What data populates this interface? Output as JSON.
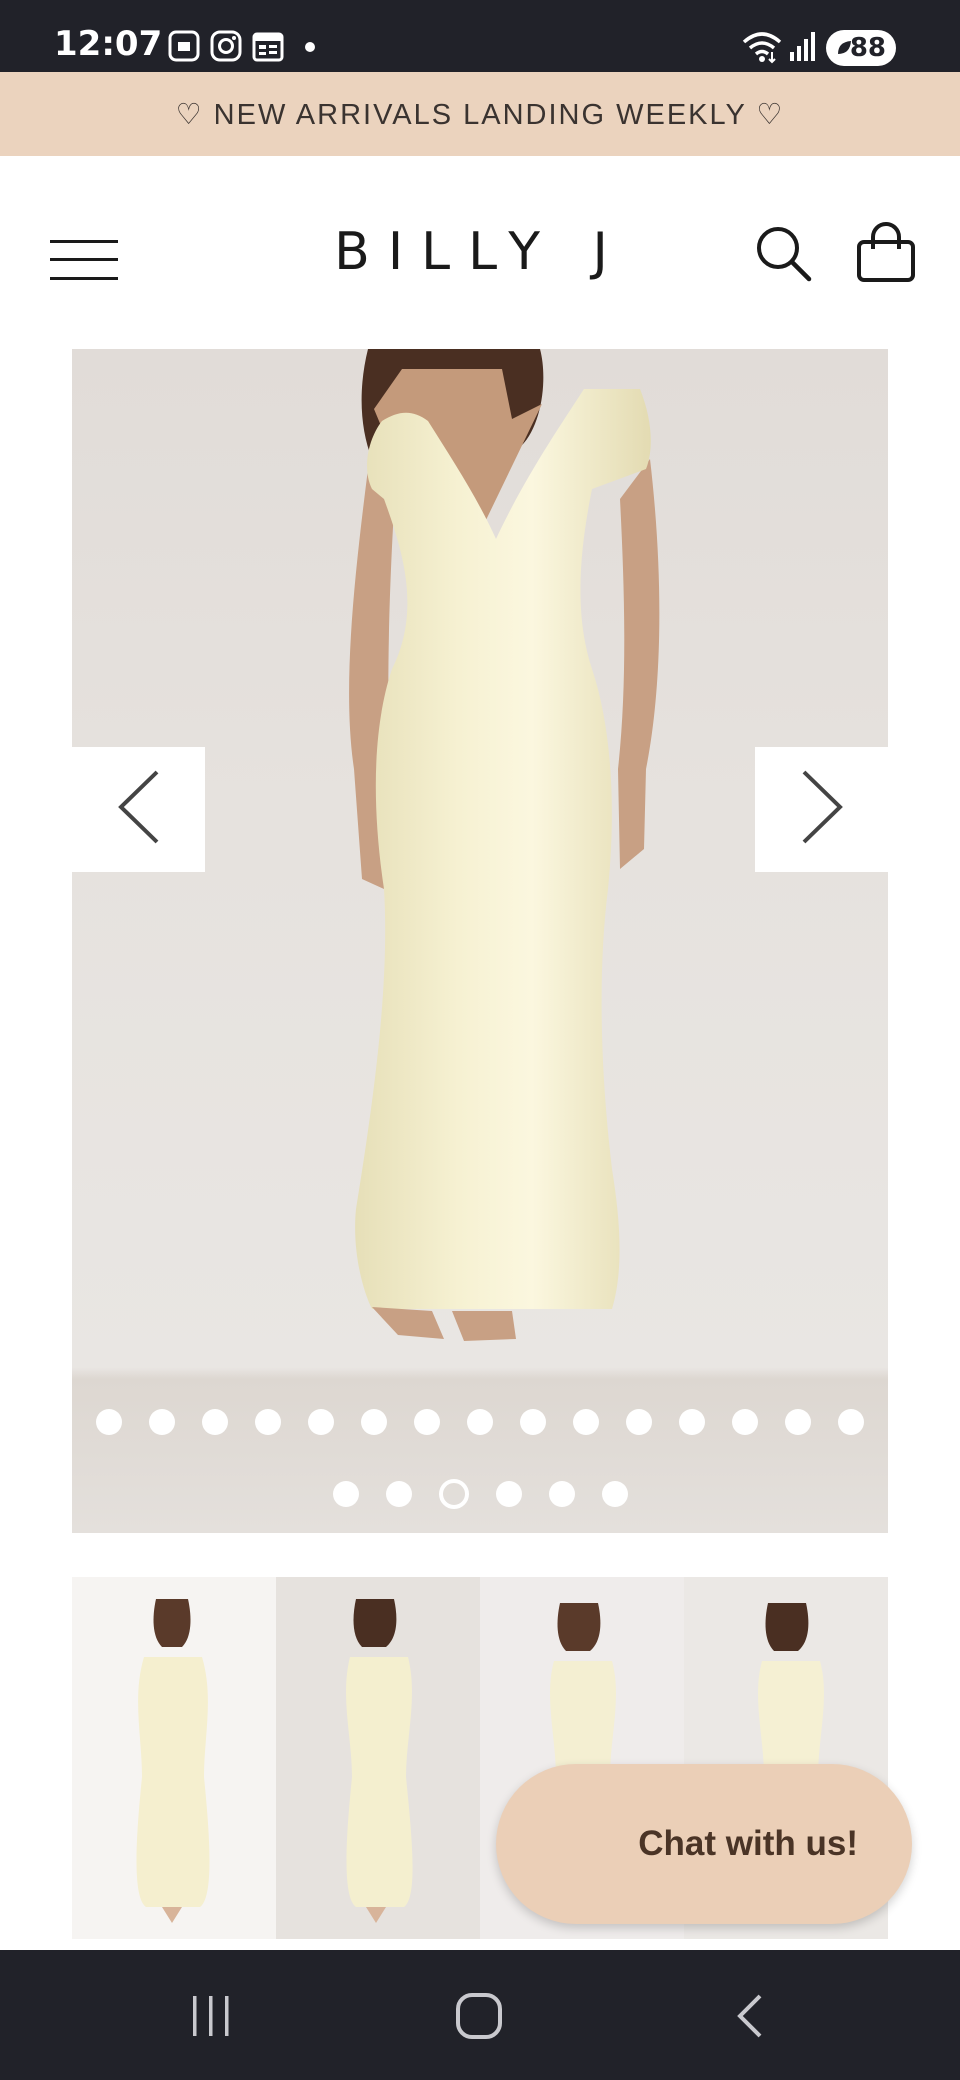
{
  "status_bar": {
    "time": "12:07",
    "battery": "88",
    "icons": [
      "screenshot-icon",
      "instagram-icon",
      "calendar-icon",
      "dot-icon",
      "wifi-icon",
      "signal-icon",
      "battery-icon"
    ]
  },
  "promo": {
    "text": "♡ NEW ARRIVALS LANDING WEEKLY ♡"
  },
  "header": {
    "logo": "BILLY J",
    "icons": [
      "menu-icon",
      "search-icon",
      "shopping-bag-icon"
    ]
  },
  "gallery": {
    "prev_icon": "chevron-left-icon",
    "next_icon": "chevron-right-icon",
    "dots_row1_count": 15,
    "dots_row2_count": 6,
    "active_dot_row2": 3
  },
  "thumbnails": {
    "count": 4
  },
  "chat": {
    "label": "Chat with us!"
  },
  "system_nav": {
    "icons": [
      "recent-apps-icon",
      "home-icon",
      "back-icon"
    ]
  },
  "colors": {
    "status_bar": "#212229",
    "promo_bg": "#ebd3be",
    "chat_bg": "#ebcfb7",
    "chat_text": "#4a3426"
  }
}
